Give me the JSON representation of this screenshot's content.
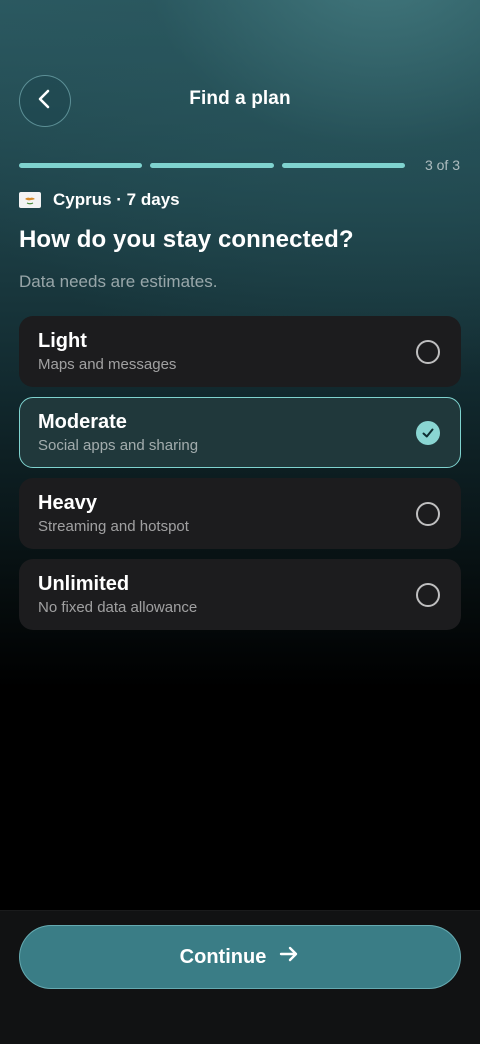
{
  "header": {
    "title": "Find a plan",
    "back_icon": "chevron-left-icon"
  },
  "progress": {
    "current_step": 3,
    "total_steps": 3,
    "label": "3 of 3",
    "color": "#7fd3cf"
  },
  "destination": {
    "flag_icon": "cyprus-flag-icon",
    "label": "Cyprus · 7 days"
  },
  "question": "How do you stay connected?",
  "note": "Data needs are estimates.",
  "options": [
    {
      "name": "Light",
      "description": "Maps and messages",
      "selected": false
    },
    {
      "name": "Moderate",
      "description": "Social apps and sharing",
      "selected": true
    },
    {
      "name": "Heavy",
      "description": "Streaming and hotspot",
      "selected": false
    },
    {
      "name": "Unlimited",
      "description": "No fixed data allowance",
      "selected": false
    }
  ],
  "footer": {
    "continue_label": "Continue",
    "continue_icon": "arrow-right-icon"
  },
  "colors": {
    "accent": "#7fd3cf",
    "button": "#3a7d86",
    "card": "#1c1c1e",
    "card_selected": "#20383b"
  }
}
